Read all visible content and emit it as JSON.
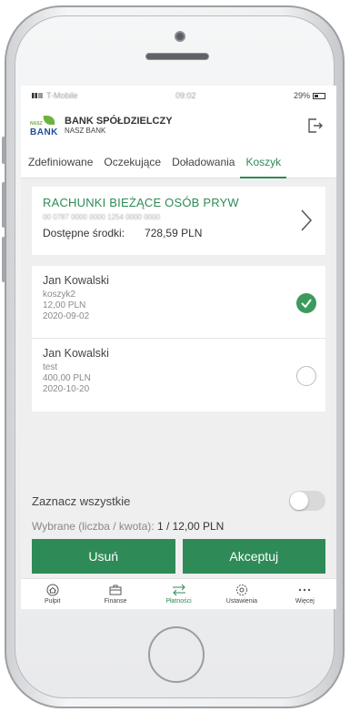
{
  "status_bar": {
    "carrier": "T-Mobile",
    "time": "09:02",
    "battery": "29%"
  },
  "bank": {
    "name": "BANK SPÓŁDZIELCZY",
    "subname": "NASZ BANK",
    "logo_small": "NASZ",
    "logo_big": "BANK"
  },
  "tabs": [
    {
      "label": "Zdefiniowane",
      "active": false
    },
    {
      "label": "Oczekujące",
      "active": false
    },
    {
      "label": "Doładowania",
      "active": false
    },
    {
      "label": "Koszyk",
      "active": true
    }
  ],
  "account": {
    "title": "RACHUNKI BIEŻĄCE OSÓB PRYW",
    "number": "00 0787 0000 0000 1254 0000 0000",
    "funds_label": "Dostępne środki:",
    "funds_value": "728,59 PLN"
  },
  "transfers": [
    {
      "name": "Jan Kowalski",
      "title": "koszyk2",
      "amount": "12,00 PLN",
      "date": "2020-09-02",
      "checked": true
    },
    {
      "name": "Jan Kowalski",
      "title": "test",
      "amount": "400,00 PLN",
      "date": "2020-10-20",
      "checked": false
    }
  ],
  "select_all_label": "Zaznacz wszystkie",
  "select_all_on": false,
  "selected_label": "Wybrane (liczba / kwota):",
  "selected_value": "1 / 12,00 PLN",
  "buttons": {
    "delete": "Usuń",
    "accept": "Akceptuj"
  },
  "nav": [
    {
      "label": "Pulpit",
      "icon": "home-icon",
      "active": false
    },
    {
      "label": "Finanse",
      "icon": "briefcase-icon",
      "active": false
    },
    {
      "label": "Płatności",
      "icon": "transfer-arrows-icon",
      "active": true
    },
    {
      "label": "Ustawienia",
      "icon": "gear-icon",
      "active": false
    },
    {
      "label": "Więcej",
      "icon": "more-icon",
      "active": false
    }
  ],
  "colors": {
    "accent": "#2e8b57",
    "brand_green": "#6cb33e",
    "brand_blue": "#1f4fa0"
  }
}
